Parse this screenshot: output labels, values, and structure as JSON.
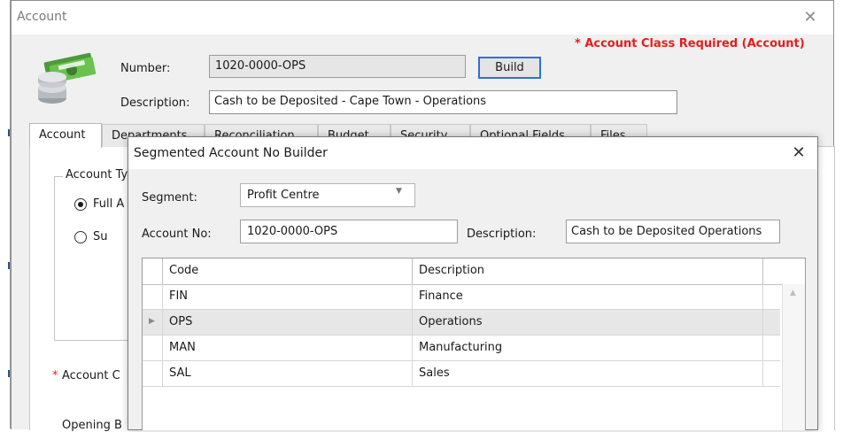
{
  "window": {
    "title": "Account",
    "close_glyph": "✕",
    "warning": "* Account Class Required (Account)",
    "icon": "money-icon"
  },
  "form": {
    "number_label": "Number:",
    "number_value": "1020-0000-OPS",
    "build_label": "Build",
    "description_label": "Description:",
    "description_value": "Cash to be Deposited - Cape Town - Operations"
  },
  "tabs": [
    {
      "label": "Account",
      "active": true
    },
    {
      "label": "Departments"
    },
    {
      "label": "Reconciliation"
    },
    {
      "label": "Budget"
    },
    {
      "label": "Security"
    },
    {
      "label": "Optional Fields"
    },
    {
      "label": "Files"
    }
  ],
  "account_tab": {
    "account_type_legend": "Account Ty",
    "radio_full": "Full A",
    "radio_sub": "Su",
    "account_class_star": "*",
    "account_class_label": "Account C",
    "opening_label": "Opening B"
  },
  "dialog": {
    "title": "Segmented Account No Builder",
    "close_glyph": "✕",
    "segment_label": "Segment:",
    "segment_value": "Profit Centre",
    "account_no_label": "Account No:",
    "account_no_value": "1020-0000-OPS",
    "description_label": "Description:",
    "description_value": "Cash to be Deposited  Operations",
    "grid": {
      "columns": [
        "Code",
        "Description"
      ],
      "rows": [
        {
          "code": "FIN",
          "description": "Finance"
        },
        {
          "code": "OPS",
          "description": "Operations",
          "selected": true
        },
        {
          "code": "MAN",
          "description": "Manufacturing"
        },
        {
          "code": "SAL",
          "description": "Sales"
        }
      ]
    }
  },
  "colors": {
    "warning": "#e41e1e",
    "build_border": "#2f6fd6",
    "window_bg": "#f0f0f0"
  }
}
